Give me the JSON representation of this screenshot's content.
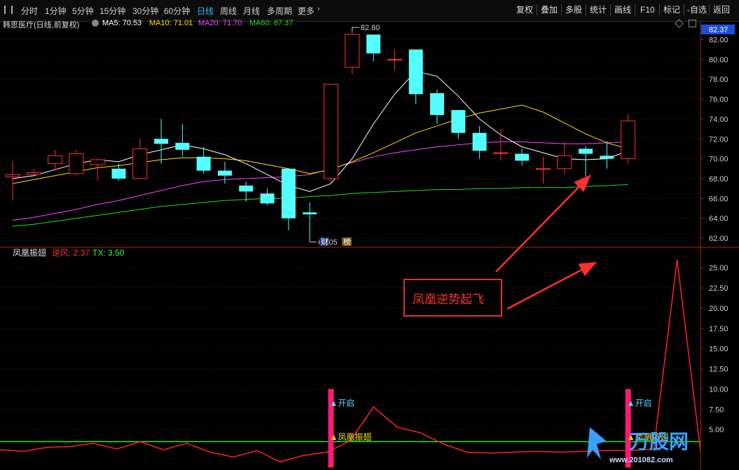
{
  "toolbar": {
    "timeframes": [
      "分时",
      "1分钟",
      "5分钟",
      "15分钟",
      "30分钟",
      "60分钟",
      "日线",
      "周线",
      "月线",
      "多周期",
      "更多"
    ],
    "active": "日线",
    "right_buttons": [
      "复权",
      "叠加",
      "多股",
      "统计",
      "画线",
      "F10",
      "标记",
      "-自选",
      "返回"
    ]
  },
  "stock_bar": {
    "name": "韩思医疗(日线,前复权)",
    "ma": [
      {
        "label": "MA5: 70.53",
        "color": "#ffffff"
      },
      {
        "label": "MA10: 71.01",
        "color": "#ffe000"
      },
      {
        "label": "MA20: 71.70",
        "color": "#ff44ff"
      },
      {
        "label": "MA60: 67.37",
        "color": "#22dd22"
      }
    ],
    "current_price": "82.37"
  },
  "price_axis": [
    "82.00",
    "80.00",
    "78.00",
    "76.00",
    "74.00",
    "72.00",
    "70.00",
    "68.00",
    "66.00",
    "64.00",
    "62.00"
  ],
  "high_label": "82.80",
  "low_label": "62.05",
  "markers": [
    "财",
    "榜"
  ],
  "indicator": {
    "name": "凤凰振翅",
    "items": [
      {
        "label": "逆风: 2.37",
        "color": "#ff3333"
      },
      {
        "label": "TX: 3.50",
        "color": "#33ff33"
      }
    ],
    "axis": [
      "25.00",
      "22.50",
      "20.00",
      "17.50",
      "15.00",
      "12.50",
      "10.00",
      "7.50",
      "5.00"
    ],
    "signal_open": "开启",
    "signal_name": "凤凰振翅",
    "annotation": "凤凰逆势起飞"
  },
  "watermark": {
    "brand": "万股网",
    "url": "www.201082.com"
  },
  "chart_data": {
    "type": "candlestick",
    "ylim": [
      61.3,
      83.3
    ],
    "candles": [
      {
        "o": 68.2,
        "c": 68.4,
        "h": 69.8,
        "l": 65.8
      },
      {
        "o": 68.4,
        "c": 68.6,
        "h": 69.0,
        "l": 68.2
      },
      {
        "o": 69.5,
        "c": 70.3,
        "h": 70.9,
        "l": 68.8
      },
      {
        "o": 68.5,
        "c": 70.5,
        "h": 70.9,
        "l": 68.3
      },
      {
        "o": 69.4,
        "c": 69.9,
        "h": 70.0,
        "l": 67.8
      },
      {
        "o": 69.0,
        "c": 68.0,
        "h": 69.5,
        "l": 67.8
      },
      {
        "o": 68.0,
        "c": 71.0,
        "h": 72.0,
        "l": 67.9
      },
      {
        "o": 72.0,
        "c": 71.5,
        "h": 74.0,
        "l": 69.5
      },
      {
        "o": 71.6,
        "c": 70.9,
        "h": 73.5,
        "l": 70.3
      },
      {
        "o": 70.2,
        "c": 68.8,
        "h": 71.2,
        "l": 68.5
      },
      {
        "o": 68.8,
        "c": 68.3,
        "h": 69.7,
        "l": 67.5
      },
      {
        "o": 67.3,
        "c": 66.7,
        "h": 67.7,
        "l": 65.7
      },
      {
        "o": 66.5,
        "c": 65.5,
        "h": 67.0,
        "l": 65.3
      },
      {
        "o": 69.0,
        "c": 64.0,
        "h": 69.0,
        "l": 62.8
      },
      {
        "o": 64.6,
        "c": 64.4,
        "h": 65.6,
        "l": 62.05
      },
      {
        "o": 68.0,
        "c": 77.5,
        "h": 77.5,
        "l": 67.5
      },
      {
        "o": 79.2,
        "c": 82.5,
        "h": 82.8,
        "l": 78.5
      },
      {
        "o": 82.5,
        "c": 80.6,
        "h": 82.5,
        "l": 79.8
      },
      {
        "o": 80.0,
        "c": 80.0,
        "h": 81.0,
        "l": 78.9
      },
      {
        "o": 81.0,
        "c": 76.5,
        "h": 81.0,
        "l": 75.5
      },
      {
        "o": 76.6,
        "c": 74.4,
        "h": 77.0,
        "l": 73.5
      },
      {
        "o": 74.9,
        "c": 72.6,
        "h": 74.9,
        "l": 72.0
      },
      {
        "o": 72.6,
        "c": 70.8,
        "h": 73.3,
        "l": 70.0
      },
      {
        "o": 70.6,
        "c": 70.6,
        "h": 73.0,
        "l": 69.8
      },
      {
        "o": 70.5,
        "c": 69.8,
        "h": 71.0,
        "l": 69.3
      },
      {
        "o": 69.0,
        "c": 69.0,
        "h": 70.2,
        "l": 67.5
      },
      {
        "o": 69.0,
        "c": 70.3,
        "h": 71.7,
        "l": 68.5
      },
      {
        "o": 71.0,
        "c": 70.5,
        "h": 71.3,
        "l": 68.2
      },
      {
        "o": 70.3,
        "c": 70.0,
        "h": 71.8,
        "l": 69.0
      },
      {
        "o": 70.0,
        "c": 73.8,
        "h": 74.5,
        "l": 69.5
      }
    ],
    "ma5": [
      68.0,
      68.3,
      68.9,
      69.5,
      69.9,
      69.7,
      70.4,
      70.9,
      71.4,
      71.0,
      70.4,
      69.5,
      68.4,
      67.3,
      66.7,
      67.5,
      70.0,
      73.5,
      76.5,
      78.8,
      78.3,
      76.3,
      74.0,
      72.4,
      71.2,
      70.6,
      70.0,
      69.9,
      70.0,
      70.8
    ],
    "ma10": [
      67.5,
      67.9,
      68.3,
      68.7,
      69.1,
      69.3,
      69.6,
      69.9,
      70.1,
      70.1,
      70.0,
      69.8,
      69.4,
      69.0,
      68.5,
      68.9,
      69.7,
      70.6,
      71.6,
      72.6,
      73.3,
      74.0,
      74.6,
      75.0,
      75.4,
      74.7,
      73.6,
      72.5,
      71.6,
      71.0
    ],
    "ma20": [
      63.8,
      64.1,
      64.5,
      64.9,
      65.4,
      65.8,
      66.3,
      66.8,
      67.3,
      67.7,
      67.9,
      68.0,
      68.1,
      68.2,
      68.4,
      69.0,
      69.6,
      70.2,
      70.6,
      70.9,
      71.2,
      71.4,
      71.6,
      71.7,
      71.7,
      71.6,
      71.5,
      71.5,
      71.6,
      71.7
    ],
    "ma60": [
      63.2,
      63.4,
      63.7,
      64.0,
      64.3,
      64.6,
      64.9,
      65.2,
      65.4,
      65.6,
      65.8,
      65.9,
      66.0,
      66.0,
      66.2,
      66.3,
      66.5,
      66.6,
      66.7,
      66.8,
      66.9,
      66.9,
      67.0,
      67.0,
      67.1,
      67.1,
      67.1,
      67.2,
      67.3,
      67.4
    ],
    "indicator_ylim": [
      0,
      27
    ],
    "nifeng": [
      2.5,
      2.3,
      2.8,
      2.9,
      3.3,
      2.6,
      3.5,
      2.5,
      3.3,
      2.2,
      1.6,
      2.4,
      1.0,
      1.8,
      2.2,
      3.6,
      7.8,
      5.3,
      4.6,
      3.2,
      2.2,
      2.1,
      2.2,
      2.3,
      2.2,
      2.3,
      2.4,
      2.4,
      2.6,
      26.0,
      2.37
    ],
    "tx": 3.5
  }
}
